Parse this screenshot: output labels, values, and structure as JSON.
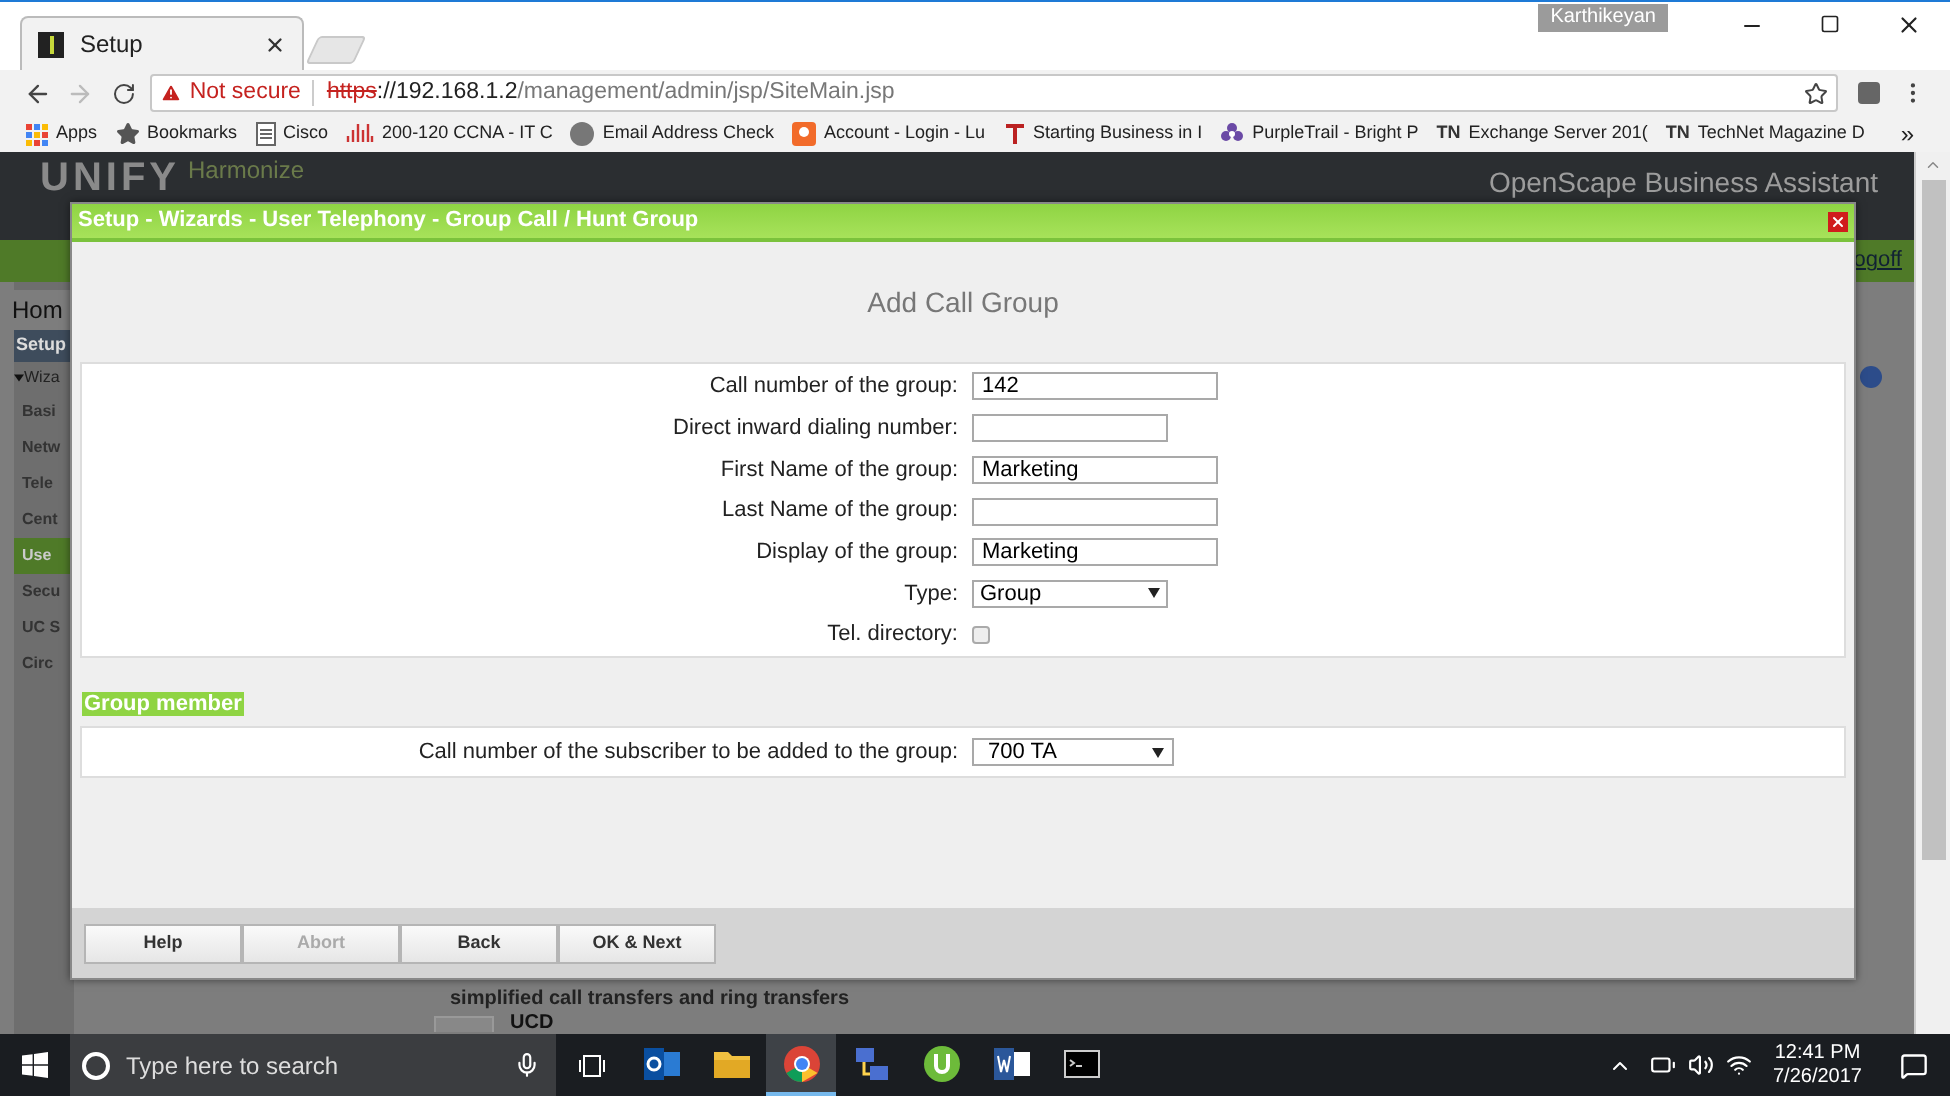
{
  "browser": {
    "tab_title": "Setup",
    "user_badge": "Karthikeyan",
    "security": "Not secure",
    "url_scheme": "https",
    "url_rest": "://192.168.1.2",
    "url_path": "/management/admin/jsp/SiteMain.jsp"
  },
  "bookmarks": [
    {
      "kind": "apps",
      "label": "Apps"
    },
    {
      "kind": "star",
      "label": "Bookmarks"
    },
    {
      "kind": "page",
      "label": "Cisco"
    },
    {
      "kind": "cisco",
      "label": "200-120 CCNA - IT C"
    },
    {
      "kind": "avatar",
      "label": "Email Address Check"
    },
    {
      "kind": "orange",
      "label": "Account - Login - Lu"
    },
    {
      "kind": "red",
      "label": "Starting Business in I"
    },
    {
      "kind": "flower",
      "label": "PurpleTrail - Bright P"
    },
    {
      "kind": "badge",
      "badge": "TN",
      "label": "Exchange Server 201("
    },
    {
      "kind": "badge",
      "badge": "TN",
      "label": "TechNet Magazine D"
    }
  ],
  "bookmarks_more": "»",
  "background_page": {
    "logo": "UNIFY",
    "brand": "Harmonize",
    "product": "OpenScape Business Assistant",
    "logoff": "ogoff",
    "sidebar": [
      {
        "label": "Hom",
        "kind": "heading",
        "selected": false
      },
      {
        "label": "Setup",
        "kind": "section",
        "selected": false
      },
      {
        "label": "Wiza",
        "kind": "group",
        "selected": false
      },
      {
        "label": "Basi",
        "kind": "item",
        "selected": false
      },
      {
        "label": "Netw",
        "kind": "item",
        "selected": false
      },
      {
        "label": "Tele",
        "kind": "item",
        "selected": false
      },
      {
        "label": "Cent",
        "kind": "item",
        "selected": false
      },
      {
        "label": "Use",
        "kind": "item",
        "selected": true
      },
      {
        "label": "Secu",
        "kind": "item",
        "selected": false
      },
      {
        "label": "UC S",
        "kind": "item",
        "selected": false
      },
      {
        "label": "Circ",
        "kind": "item",
        "selected": false
      }
    ],
    "list_texts": [
      "simplified call transfers and ring transfers",
      "UCD"
    ]
  },
  "dialog": {
    "title": "Setup - Wizards - User Telephony - Group Call / Hunt Group",
    "heading": "Add Call Group",
    "fields": [
      {
        "kind": "text",
        "label": "Call number of the group:",
        "value": "142"
      },
      {
        "kind": "text",
        "label": "Direct inward dialing number:"
      },
      {
        "kind": "text",
        "label": "First Name of the group:",
        "value": "Marketing"
      },
      {
        "kind": "text",
        "label": "Last Name of the group:"
      },
      {
        "kind": "text",
        "label": "Display of the group:",
        "value": "Marketing"
      },
      {
        "kind": "select",
        "label": "Type:",
        "value": "Group"
      },
      {
        "kind": "checkbox",
        "label": "Tel. directory:",
        "checked": false
      }
    ],
    "member_legend": "Group member",
    "member_field": {
      "label": "Call number of the subscriber to be added to the group:",
      "value": "700 TA"
    },
    "buttons": [
      {
        "label": "Help",
        "disabled": false
      },
      {
        "label": "Abort",
        "disabled": true
      },
      {
        "label": "Back",
        "disabled": false
      },
      {
        "label": "OK & Next",
        "disabled": false
      }
    ]
  },
  "taskbar": {
    "search_placeholder": "Type here to search",
    "apps": [
      {
        "kind": "outlook",
        "selected": false
      },
      {
        "kind": "folder",
        "selected": false
      },
      {
        "kind": "chrome",
        "selected": true
      },
      {
        "kind": "network",
        "selected": false
      },
      {
        "kind": "torrent",
        "selected": false
      },
      {
        "kind": "word",
        "selected": false
      },
      {
        "kind": "terminal",
        "selected": false
      }
    ],
    "time": "12:41 PM",
    "date": "7/26/2017"
  }
}
